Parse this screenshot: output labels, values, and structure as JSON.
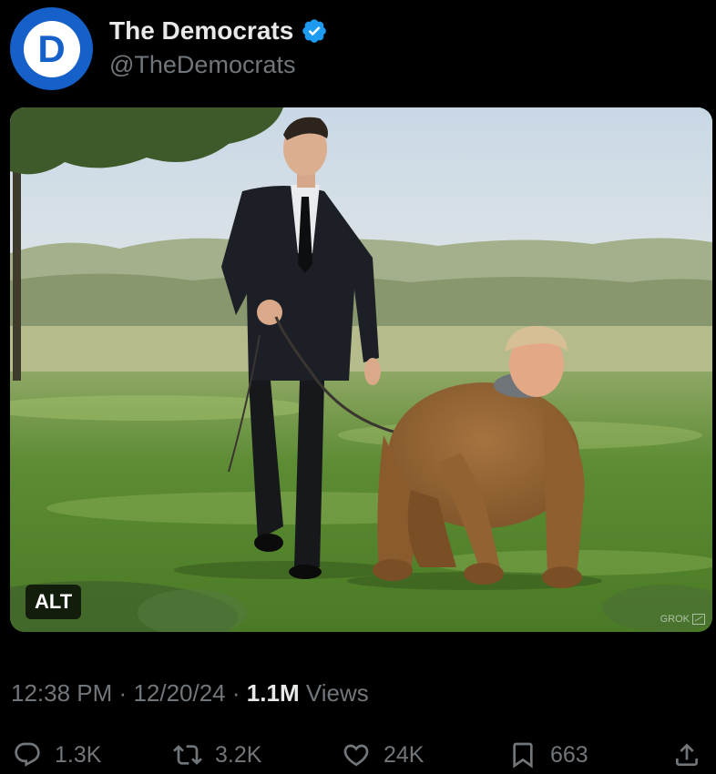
{
  "author": {
    "display_name": "The Democrats",
    "handle": "@TheDemocrats",
    "avatar_letter": "D",
    "verified": true
  },
  "media": {
    "alt_badge": "ALT",
    "watermark": "GROK"
  },
  "meta": {
    "time": "12:38 PM",
    "separator": "·",
    "date": "12/20/24",
    "views_count": "1.1M",
    "views_label": "Views"
  },
  "actions": {
    "replies": "1.3K",
    "reposts": "3.2K",
    "likes": "24K",
    "bookmarks": "663"
  },
  "colors": {
    "background": "#000000",
    "text_primary": "#e7e9ea",
    "text_secondary": "#71767b",
    "verified_blue": "#1d9bf0",
    "brand_blue": "#1560c9"
  }
}
